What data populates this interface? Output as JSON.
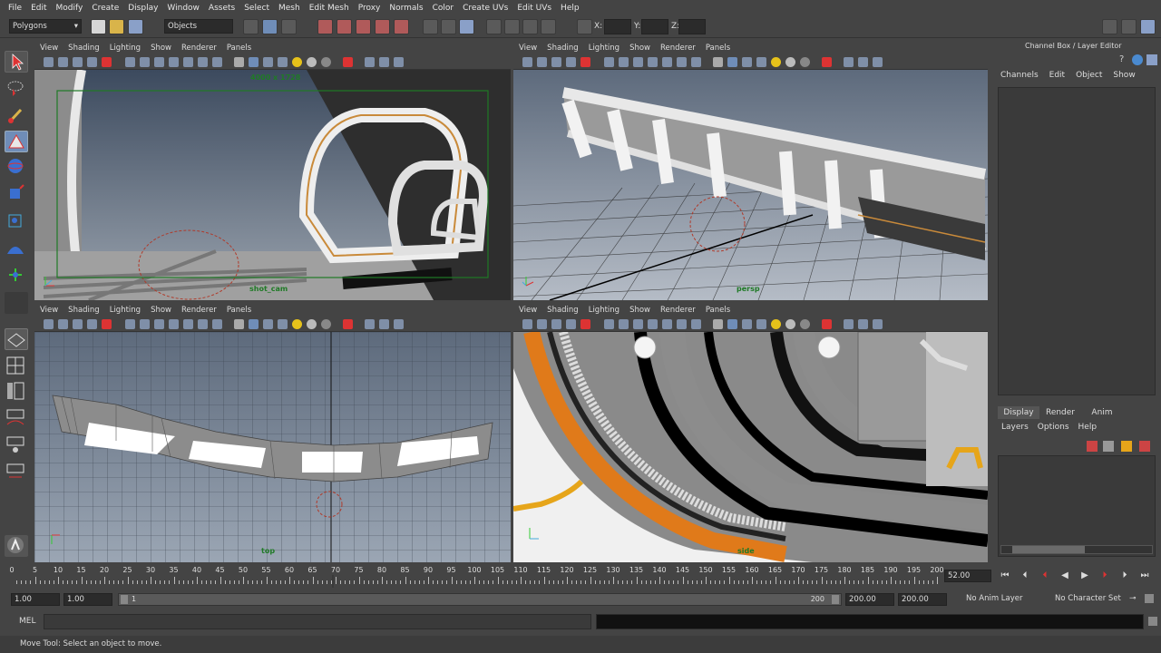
{
  "menu": [
    "File",
    "Edit",
    "Modify",
    "Create",
    "Display",
    "Window",
    "Assets",
    "Select",
    "Mesh",
    "Edit Mesh",
    "Proxy",
    "Normals",
    "Color",
    "Create UVs",
    "Edit UVs",
    "Help"
  ],
  "shelf": {
    "mode": "Polygons",
    "selection_mask": "Objects",
    "x_label": "X:",
    "y_label": "Y:",
    "z_label": "Z:"
  },
  "viewport_menu": [
    "View",
    "Shading",
    "Lighting",
    "Show",
    "Renderer",
    "Panels"
  ],
  "viewports": {
    "top_left": {
      "camera": "shot_cam",
      "resolution": "4000 x 1728"
    },
    "top_right": {
      "camera": "persp"
    },
    "bottom_left": {
      "camera": "top"
    },
    "bottom_right": {
      "camera": "side"
    }
  },
  "channel_box": {
    "title": "Channel Box / Layer Editor",
    "menus": [
      "Channels",
      "Edit",
      "Object",
      "Show"
    ],
    "layer_tabs": [
      "Display",
      "Render",
      "Anim"
    ],
    "layer_menus": [
      "Layers",
      "Options",
      "Help"
    ]
  },
  "timeline": {
    "ticks": [
      "5",
      "10",
      "15",
      "20",
      "25",
      "30",
      "35",
      "40",
      "45",
      "50",
      "55",
      "60",
      "65",
      "70",
      "75",
      "80",
      "85",
      "90",
      "95",
      "100",
      "105",
      "110",
      "115",
      "120",
      "125",
      "130",
      "135",
      "140",
      "145",
      "150",
      "155",
      "160",
      "165",
      "170",
      "175",
      "180",
      "185",
      "190",
      "195",
      "200"
    ],
    "start_tick": "0",
    "current_frame": "52.00"
  },
  "range": {
    "start": "1.00",
    "playback_start": "1.00",
    "slider_start": "1",
    "slider_end": "200",
    "playback_end": "200.00",
    "end": "200.00",
    "anim_layer": "No Anim Layer",
    "character_set": "No Character Set"
  },
  "command_line": {
    "label": "MEL"
  },
  "help_line": "Move Tool: Select an object to move.",
  "colors": {
    "accent_green": "#1f7a26",
    "panel": "#444444",
    "field": "#2b2b2b"
  }
}
